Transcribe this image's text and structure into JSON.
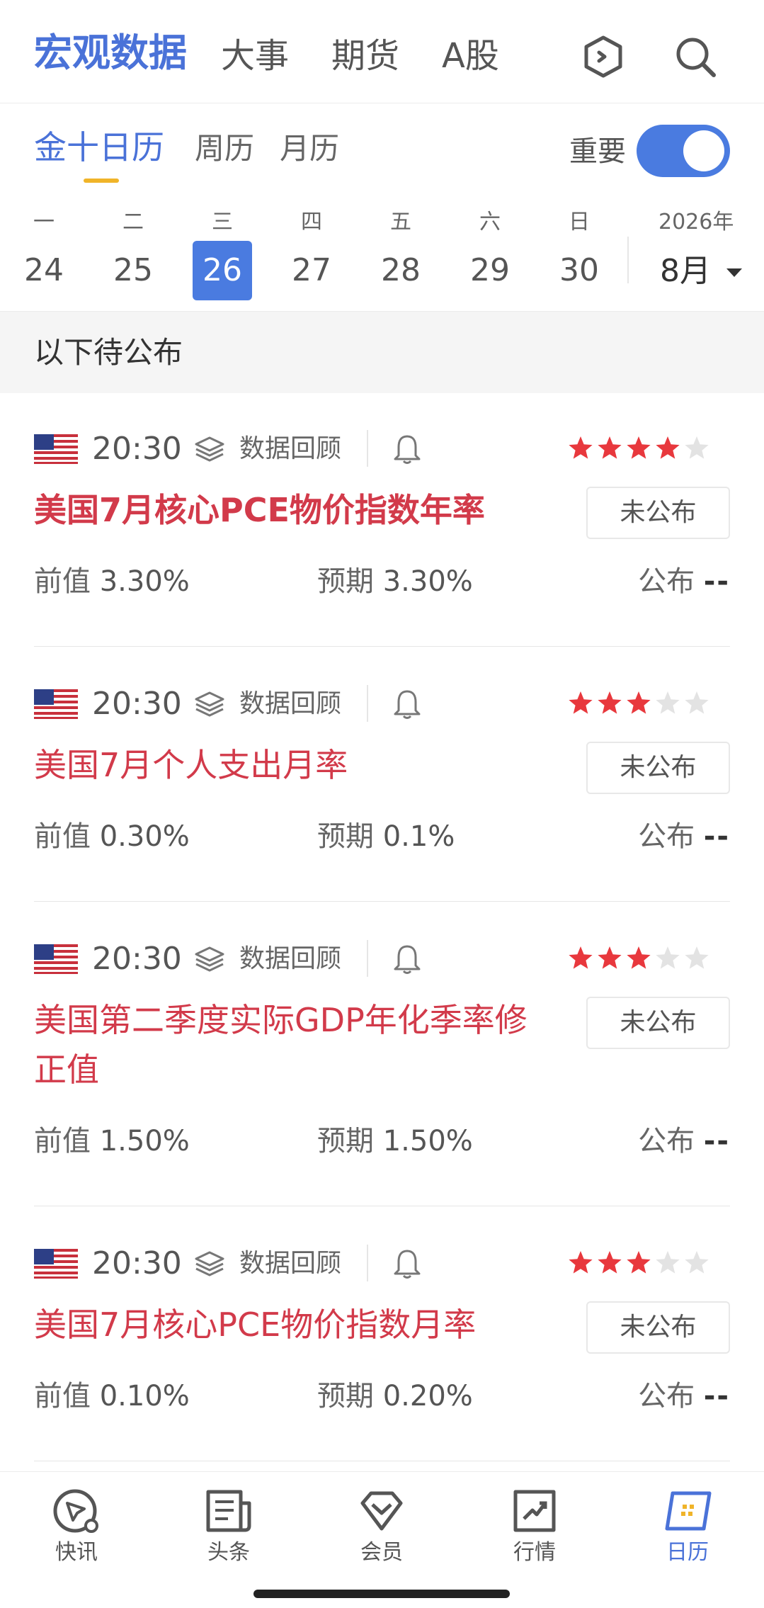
{
  "top_nav": {
    "tabs": [
      "宏观数据",
      "大事",
      "期货",
      "A股"
    ],
    "active_index": 0,
    "icons": [
      "hexagon-icon",
      "search-icon"
    ]
  },
  "calendar_tabs": {
    "tabs": [
      "金十日历",
      "周历",
      "月历"
    ],
    "active_index": 0,
    "important_label": "重要",
    "important_on": true
  },
  "week": {
    "days": [
      {
        "weekday": "一",
        "date": "24"
      },
      {
        "weekday": "二",
        "date": "25"
      },
      {
        "weekday": "三",
        "date": "26"
      },
      {
        "weekday": "四",
        "date": "27"
      },
      {
        "weekday": "五",
        "date": "28"
      },
      {
        "weekday": "六",
        "date": "29"
      },
      {
        "weekday": "日",
        "date": "30"
      }
    ],
    "selected_index": 2,
    "year": "2026年",
    "month": "8月"
  },
  "section_title": "以下待公布",
  "events": [
    {
      "time": "20:30",
      "review_label": "数据回顾",
      "stars": 4,
      "title": "美国7月核心PCE物价指数年率",
      "title_bold": true,
      "status": "未公布",
      "prev_label": "前值",
      "prev_value": "3.30%",
      "expected_label": "预期",
      "expected_value": "3.30%",
      "actual_label": "公布",
      "actual_value": "--"
    },
    {
      "time": "20:30",
      "review_label": "数据回顾",
      "stars": 3,
      "title": "美国7月个人支出月率",
      "title_bold": false,
      "status": "未公布",
      "prev_label": "前值",
      "prev_value": "0.30%",
      "expected_label": "预期",
      "expected_value": "0.1%",
      "actual_label": "公布",
      "actual_value": "--"
    },
    {
      "time": "20:30",
      "review_label": "数据回顾",
      "stars": 3,
      "title": "美国第二季度实际GDP年化季率修正值",
      "title_line1": "美国第二季度实际GDP年化季率修",
      "title_line2": "正值",
      "title_bold": false,
      "status": "未公布",
      "prev_label": "前值",
      "prev_value": "1.50%",
      "expected_label": "预期",
      "expected_value": "1.50%",
      "actual_label": "公布",
      "actual_value": "--"
    },
    {
      "time": "20:30",
      "review_label": "数据回顾",
      "stars": 3,
      "title": "美国7月核心PCE物价指数月率",
      "title_bold": false,
      "status": "未公布",
      "prev_label": "前值",
      "prev_value": "0.10%",
      "expected_label": "预期",
      "expected_value": "0.20%",
      "actual_label": "公布",
      "actual_value": "--"
    }
  ],
  "tab_bar": {
    "items": [
      {
        "label": "快讯",
        "icon": "compass-icon"
      },
      {
        "label": "头条",
        "icon": "newspaper-icon"
      },
      {
        "label": "会员",
        "icon": "diamond-icon"
      },
      {
        "label": "行情",
        "icon": "chart-icon"
      },
      {
        "label": "日历",
        "icon": "calendar-icon"
      }
    ],
    "active_index": 4
  },
  "colors": {
    "accent": "#4a72d8",
    "event_title": "#d23a4a",
    "star_on": "#e8383d",
    "star_off": "#e3e3e3",
    "underline": "#f0b429"
  }
}
